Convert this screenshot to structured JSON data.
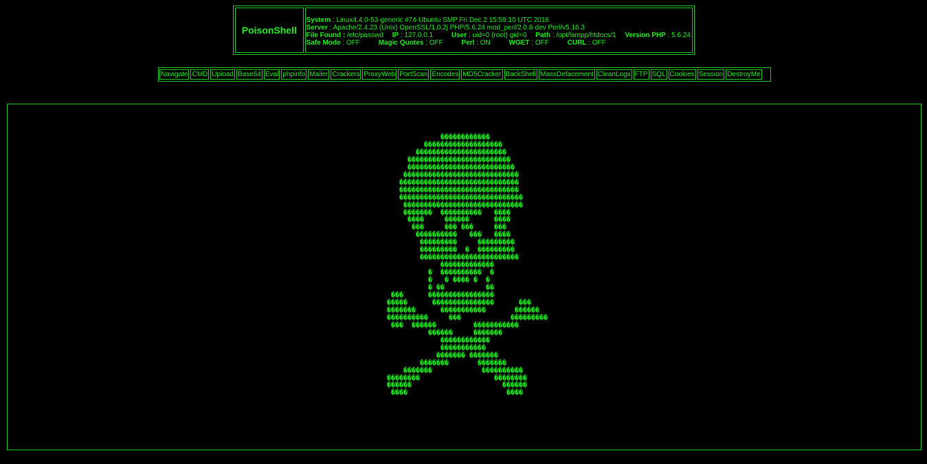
{
  "brand": {
    "title": "PoisonShell"
  },
  "system_info": {
    "system_label": "System",
    "system_value": "Linux4.4.0-53-generic #74-Ubuntu SMP Fri Dec 2 15:59:10 UTC 2016",
    "server_label": "Server",
    "server_value": "Apache/2.4.23 (Unix) OpenSSL/1.0.2j PHP/5.6.24 mod_perl/2.0.8-dev Perl/v5.16.3",
    "file_label": "File Found :",
    "file_value": "/etc/passwd",
    "ip_label": "IP",
    "ip_value": "127.0.0.1",
    "user_label": "User",
    "user_value": "uid=0 (root) gid=0",
    "path_label": "Path",
    "path_value": "/opt/lampp/htdocs/1",
    "php_label": "Version PHP",
    "php_value": "5.6.24",
    "safe_label": "Safe Mode",
    "safe_value": "OFF",
    "magic_label": "Magic Quotes",
    "magic_value": "OFF",
    "perl_label": "Perl",
    "perl_value": "ON",
    "wget_label": "WGET",
    "wget_value": "OFF",
    "curl_label": "CURL",
    "curl_value": "OFF"
  },
  "nav": [
    "Navigate",
    "CMD",
    "Upload",
    "Base64",
    "Eval",
    "phpinfo",
    "Mailer",
    "Crackers",
    "ProxyWeb",
    "PortScan",
    "Encodes",
    "MD5Cracker",
    "BackShell",
    "MassDefacement",
    "CleanLogs",
    "FTP",
    "SQL",
    "Cookies",
    "Session",
    "DestroyMe"
  ],
  "ascii_art": "              ������������\n          �������������������\n        ����������������������\n      �������������������������\n      ��������������������������\n     ����������������������������\n    �����������������������������\n    �����������������������������\n    ������������������������������\n     �����������������������������\n     �������  ����������   ����\n      ����     ������      ����\n       ���     ��� ���     ���\n        ����������   ���   ����\n         ���������     ���������\n         ���������  �  ���������\n         ������������������������\n              �������������\n           �  ����������  �\n           �   � ���� �  �\n           � ��          ��\n  ���      ����������������\n �����      ���������������      ���\n �������      �����������       ������\n ����������     ���            ���������\n  ���  ������         �����������\n           ������     �������\n              ������������\n              �����������\n             ������� �������\n         �������       �������\n     �������            ����������\n ��������                  ��������\n ������                      ������\n  ����                        ����"
}
